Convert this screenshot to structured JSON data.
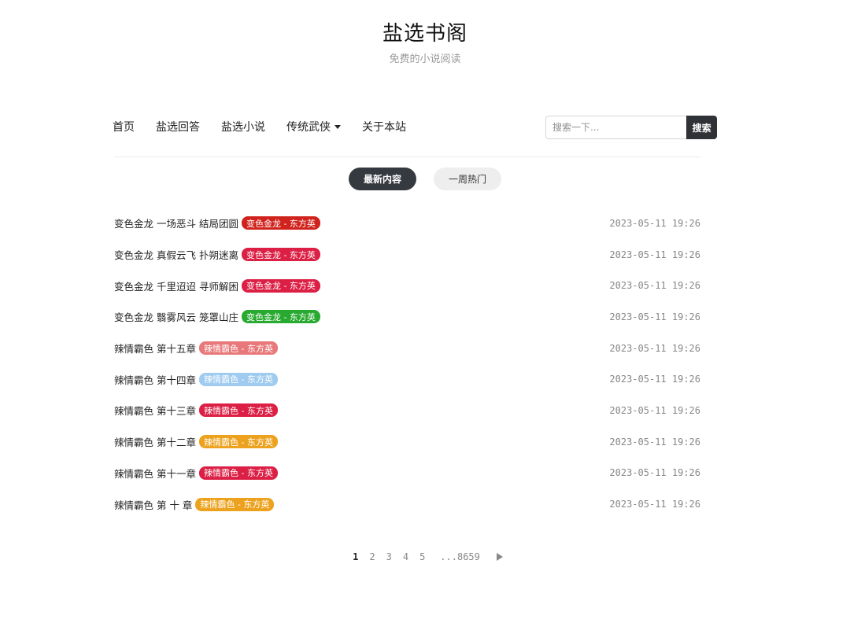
{
  "site": {
    "title": "盐选书阁",
    "subtitle": "免费的小说阅读"
  },
  "nav": [
    {
      "label": "首页",
      "active": true
    },
    {
      "label": "盐选回答",
      "active": false
    },
    {
      "label": "盐选小说",
      "active": false
    },
    {
      "label": "传统武侠",
      "active": false,
      "dropdown": true
    },
    {
      "label": "关于本站",
      "active": false
    }
  ],
  "search": {
    "placeholder": "搜索一下...",
    "button": "搜索"
  },
  "tabs": {
    "latest": "最新内容",
    "weekly_hot": "一周热门"
  },
  "posts": [
    {
      "title": "变色金龙 一场恶斗 结局团圆",
      "tag": "变色金龙 - 东方英",
      "tag_color": "#d0231d",
      "date": "2023-05-11 19:26"
    },
    {
      "title": "变色金龙 真假云飞 扑朔迷离",
      "tag": "变色金龙 - 东方英",
      "tag_color": "#dc1f44",
      "date": "2023-05-11 19:26"
    },
    {
      "title": "变色金龙 千里迢迢 寻师解困",
      "tag": "变色金龙 - 东方英",
      "tag_color": "#dc1f44",
      "date": "2023-05-11 19:26"
    },
    {
      "title": "变色金龙 翳雾风云 笼罩山庄",
      "tag": "变色金龙 - 东方英",
      "tag_color": "#28a92f",
      "date": "2023-05-11 19:26"
    },
    {
      "title": "辣情霸色 第十五章",
      "tag": "辣情霸色 - 东方英",
      "tag_color": "#e8787a",
      "date": "2023-05-11 19:26"
    },
    {
      "title": "辣情霸色 第十四章",
      "tag": "辣情霸色 - 东方英",
      "tag_color": "#9ecbef",
      "date": "2023-05-11 19:26"
    },
    {
      "title": "辣情霸色 第十三章",
      "tag": "辣情霸色 - 东方英",
      "tag_color": "#dc1f44",
      "date": "2023-05-11 19:26"
    },
    {
      "title": "辣情霸色 第十二章",
      "tag": "辣情霸色 - 东方英",
      "tag_color": "#eda21f",
      "date": "2023-05-11 19:26"
    },
    {
      "title": "辣情霸色 第十一章",
      "tag": "辣情霸色 - 东方英",
      "tag_color": "#dc1f44",
      "date": "2023-05-11 19:26"
    },
    {
      "title": "辣情霸色 第 十 章",
      "tag": "辣情霸色 - 东方英",
      "tag_color": "#eda21f",
      "date": "2023-05-11 19:26"
    }
  ],
  "pagination": {
    "pages": [
      "1",
      "2",
      "3",
      "4",
      "5"
    ],
    "current": "1",
    "last": "...8659"
  },
  "colors": {
    "accent": "#c8161d",
    "dark": "#343a40"
  }
}
